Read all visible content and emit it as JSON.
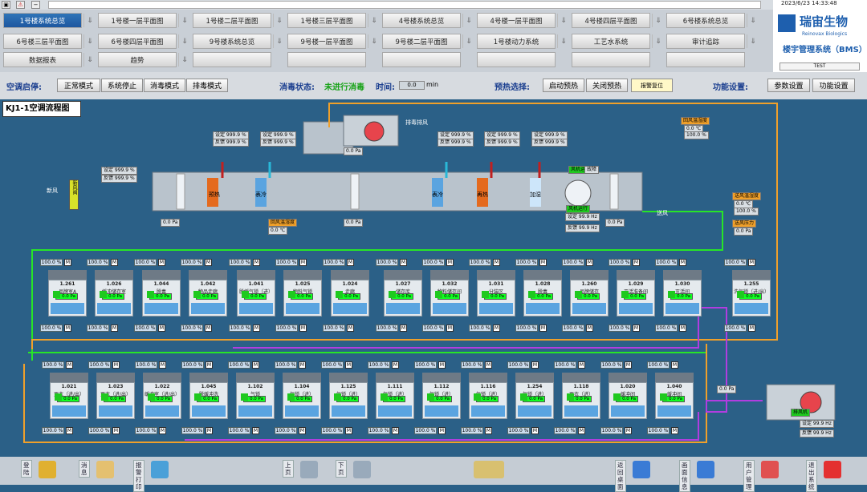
{
  "datetime": "2023/6/23 14:33:48",
  "company": "瑞宙生物",
  "company_en": "Reinovax Biologics",
  "system": "楼宇管理系统（BMS）",
  "user": "TEST",
  "tabs": [
    {
      "label": "1号楼系统总览",
      "active": true
    },
    {
      "label": "1号楼一层平面图"
    },
    {
      "label": "1号楼二层平面图"
    },
    {
      "label": "1号楼三层平面图"
    },
    {
      "label": "4号楼系统总览"
    },
    {
      "label": "4号楼一层平面图"
    },
    {
      "label": "4号楼四层平面图"
    },
    {
      "label": "6号楼系统总览"
    },
    {
      "label": "6号楼三层平面图"
    },
    {
      "label": "6号楼四层平面图"
    },
    {
      "label": "9号楼系统总览"
    },
    {
      "label": "9号楼一层平面图"
    },
    {
      "label": "9号楼二层平面图"
    },
    {
      "label": "1号楼动力系统"
    },
    {
      "label": "工艺水系统"
    },
    {
      "label": "审计追踪"
    },
    {
      "label": "数据报表"
    },
    {
      "label": "趋势"
    }
  ],
  "control": {
    "ac_start_label": "空调启停:",
    "btn_normal": "正常模式",
    "btn_stop": "系统停止",
    "btn_disinfect": "消毒模式",
    "btn_exhaust": "排毒模式",
    "dis_status_label": "消毒状态:",
    "dis_status": "未进行消毒",
    "time_label": "时间:",
    "time_value": "0.0",
    "time_unit": "min",
    "preheat_label": "预热选择:",
    "btn_preheat_on": "启动预热",
    "btn_preheat_off": "关闭预热",
    "btn_alarm_reset": "报警复位",
    "func_label": "功能设置:",
    "btn_params": "参数设置",
    "btn_func": "功能设置"
  },
  "diagram": {
    "title": "KJ1-1空调流程图",
    "fresh_air": "新风",
    "fresh_box": "新风阀",
    "return_label": "排毒排风",
    "supply": "送风",
    "setpoint": "设定 999.9 %",
    "feedback": "反馈 999.9 %",
    "coil1": "预热",
    "coil2": "表冷",
    "coil3": "表冷",
    "coil4": "再热",
    "humid": "加湿",
    "pa": "0.0 Pa",
    "temp": "0.0 ℃",
    "hz_set": "设定 99.9 Hz",
    "hz_fb": "反馈 99.9 Hz",
    "return_temp": "回风温湿度",
    "supply_temp": "送风温湿度",
    "supply_press": "送风压力",
    "fan_status": "风机运行",
    "fan_fault": "故障",
    "pct": "100.0 %",
    "rooms_top": [
      {
        "id": "1.261",
        "name": "品牌室A"
      },
      {
        "id": "1.026",
        "name": "缓冲储存室"
      },
      {
        "id": "1.044",
        "name": "脱毒"
      },
      {
        "id": "1.042",
        "name": "物品走廊"
      },
      {
        "id": "1.041",
        "name": "脱缓气锁（进）"
      },
      {
        "id": "1.025",
        "name": "物料气锁"
      },
      {
        "id": "1.024",
        "name": "走廊"
      },
      {
        "id": "1.027",
        "name": "储存库"
      },
      {
        "id": "1.032",
        "name": "物料储存间"
      },
      {
        "id": "1.031",
        "name": "分装区"
      },
      {
        "id": "1.028",
        "name": "脱毒"
      },
      {
        "id": "1.260",
        "name": "品牌储存"
      },
      {
        "id": "1.029",
        "name": "灭活准备间"
      },
      {
        "id": "1.030",
        "name": "灭活间"
      },
      {
        "id": "1.255",
        "name": "洗气锁（进/出）"
      }
    ],
    "rooms_bot": [
      {
        "id": "1.021",
        "name": "更衣（进/出）"
      },
      {
        "id": "1.023",
        "name": "更衣（进/出）"
      },
      {
        "id": "1.022",
        "name": "缓冲室（进/出）"
      },
      {
        "id": "1.045",
        "name": "脱缓冲洗"
      },
      {
        "id": "1.102",
        "name": "气锁"
      },
      {
        "id": "1.104",
        "name": "气锁（进）"
      },
      {
        "id": "1.125",
        "name": "气锁（进）"
      },
      {
        "id": "1.111",
        "name": "气锁（进）"
      },
      {
        "id": "1.112",
        "name": "气锁（进）"
      },
      {
        "id": "1.116",
        "name": "气锁（进）"
      },
      {
        "id": "1.254",
        "name": "气锁（进）"
      },
      {
        "id": "1.118",
        "name": "更衣（进）"
      },
      {
        "id": "1.020",
        "name": "缓冲间"
      },
      {
        "id": "1.040",
        "name": "缓冲间"
      }
    ],
    "exhaust_fan": "排风机"
  },
  "nav": [
    {
      "label": "登陆"
    },
    {
      "label": "消息"
    },
    {
      "label": "报警打印"
    },
    {
      "label": "上页"
    },
    {
      "label": "下页"
    },
    {
      "label": "返回桌面"
    },
    {
      "label": "画面信息"
    },
    {
      "label": "用户管理"
    },
    {
      "label": "退出系统"
    }
  ],
  "colors": {
    "accent": "#1e57a0",
    "bg": "#2b6087",
    "green": "#1fc91f",
    "orange": "#f0a02a",
    "purple": "#b13de0"
  }
}
